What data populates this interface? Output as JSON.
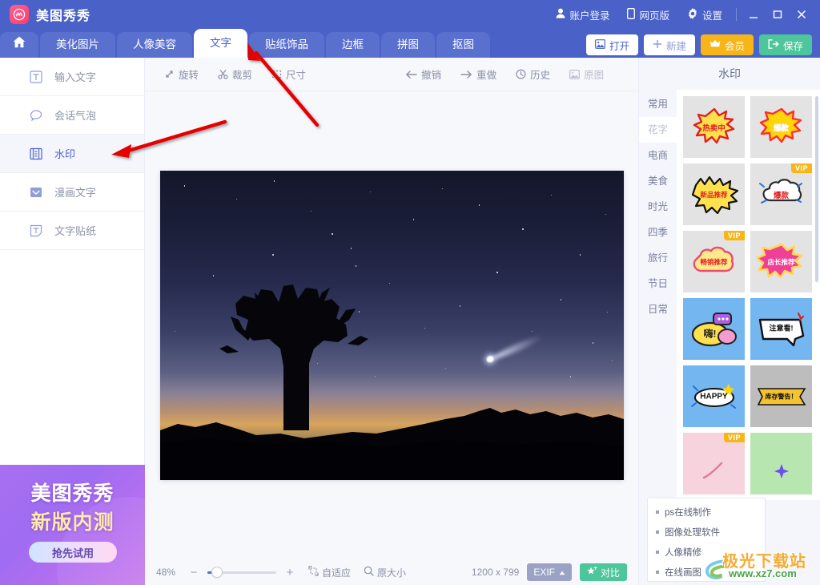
{
  "titlebar": {
    "app_name": "美图秀秀",
    "logo_icon": "meitu-logo-icon",
    "account": {
      "label": "账户登录",
      "icon": "user-icon"
    },
    "web_version": {
      "label": "网页版",
      "icon": "phone-icon"
    },
    "settings": {
      "label": "设置",
      "icon": "gear-icon"
    },
    "minimize_icon": "minimize-icon",
    "maximize_icon": "maximize-icon",
    "close_icon": "close-icon"
  },
  "tabs": {
    "home_icon": "home-icon",
    "items": [
      {
        "label": "美化图片",
        "active": false
      },
      {
        "label": "人像美容",
        "active": false
      },
      {
        "label": "文字",
        "active": true
      },
      {
        "label": "贴纸饰品",
        "active": false
      },
      {
        "label": "边框",
        "active": false
      },
      {
        "label": "拼图",
        "active": false
      },
      {
        "label": "抠图",
        "active": false
      }
    ],
    "actions": [
      {
        "label": "打开",
        "icon": "image-icon",
        "style": "white"
      },
      {
        "label": "新建",
        "icon": "plus-icon",
        "style": "ghost"
      },
      {
        "label": "会员",
        "icon": "crown-icon",
        "style": "gold"
      },
      {
        "label": "保存",
        "icon": "save-icon",
        "style": "green"
      }
    ]
  },
  "sidebar": {
    "items": [
      {
        "label": "输入文字",
        "icon": "text-input-icon",
        "active": false
      },
      {
        "label": "会话气泡",
        "icon": "speech-bubble-icon",
        "active": false
      },
      {
        "label": "水印",
        "icon": "watermark-icon",
        "active": true
      },
      {
        "label": "漫画文字",
        "icon": "comic-text-icon",
        "active": false
      },
      {
        "label": "文字贴纸",
        "icon": "text-sticker-icon",
        "active": false
      }
    ],
    "promo": {
      "line1": "美图秀秀",
      "line2": "新版内测",
      "button": "抢先试用"
    }
  },
  "toolbar": {
    "items": [
      {
        "label": "旋转",
        "icon": "rotate-icon",
        "dim": false
      },
      {
        "label": "裁剪",
        "icon": "crop-icon",
        "dim": false
      },
      {
        "label": "尺寸",
        "icon": "resize-icon",
        "dim": false
      }
    ],
    "history_items": [
      {
        "label": "撤销",
        "icon": "undo-arrow-icon",
        "dim": false
      },
      {
        "label": "重做",
        "icon": "redo-arrow-icon",
        "dim": false
      },
      {
        "label": "历史",
        "icon": "clock-icon",
        "dim": false
      },
      {
        "label": "原图",
        "icon": "original-image-icon",
        "dim": true
      }
    ]
  },
  "statusbar": {
    "zoom_percent": "48%",
    "zoom_out_icon": "minus-icon",
    "zoom_in_icon": "plus-icon",
    "fit_label": "自适应",
    "fit_icon": "fit-screen-icon",
    "actual_label": "原大小",
    "actual_icon": "magnifier-icon",
    "dimensions": "1200 x 799",
    "exif_label": "EXIF",
    "exif_caret_icon": "caret-up-icon",
    "compare_label": "对比",
    "compare_icon": "star-compare-icon"
  },
  "right_panel": {
    "title": "水印",
    "categories": [
      {
        "label": "常用",
        "active": false
      },
      {
        "label": "花字",
        "active": true
      },
      {
        "label": "电商",
        "active": false
      },
      {
        "label": "美食",
        "active": false
      },
      {
        "label": "时光",
        "active": false
      },
      {
        "label": "四季",
        "active": false
      },
      {
        "label": "旅行",
        "active": false
      },
      {
        "label": "节日",
        "active": false
      },
      {
        "label": "日常",
        "active": false
      }
    ],
    "stickers": [
      {
        "label": "热卖中",
        "vip": false,
        "bg": "#e3e3e3",
        "burst": "#ffe14d",
        "outline": "#e02020",
        "text_color": "#e02020"
      },
      {
        "label": "爆款",
        "vip": false,
        "bg": "#e3e3e3",
        "burst": "#ffd60a",
        "outline": "#ff2d2d",
        "text_color": "#ffffff"
      },
      {
        "label": "新品推荐",
        "vip": false,
        "bg": "#e3e3e3",
        "burst": "#ffe14d",
        "outline": "#111111",
        "text_color": "#e02020"
      },
      {
        "label": "爆款",
        "vip": true,
        "bg": "#e3e3e3",
        "burst": "#ffffff",
        "outline": "#3b7de0",
        "text_color": "#e02020"
      },
      {
        "label": "畅销推荐",
        "vip": true,
        "bg": "#e3e3e3",
        "burst": "#ffe98a",
        "outline": "#ef4b6b",
        "text_color": "#e02020"
      },
      {
        "label": "店长推荐",
        "vip": false,
        "bg": "#e3e3e3",
        "burst": "#ef3f96",
        "outline": "#ffd84d",
        "text_color": "#ffffff"
      },
      {
        "label": "嗨!",
        "vip": false,
        "bg": "#74b6f0",
        "burst": "#ffe14d",
        "outline": "#222222",
        "text_color": "#222222"
      },
      {
        "label": "注意看!",
        "vip": false,
        "bg": "#74b6f0",
        "burst": "#ffffff",
        "outline": "#111111",
        "text_color": "#111111"
      },
      {
        "label": "HAPPY",
        "vip": false,
        "bg": "#74b6f0",
        "burst": "#ffffff",
        "outline": "#111111",
        "text_color": "#111111"
      },
      {
        "label": "库存警告！",
        "vip": false,
        "bg": "#bdbdbd",
        "burst": "#f5c330",
        "outline": "#111111",
        "text_color": "#111111"
      },
      {
        "label": "",
        "vip": true,
        "bg": "#f7d3de",
        "burst": "#f7d3de",
        "outline": "#e07ba0",
        "text_color": "#e07ba0"
      },
      {
        "label": "",
        "vip": false,
        "bg": "#b8e6b0",
        "burst": "#b8e6b0",
        "outline": "#6b4df0",
        "text_color": "#6b4df0"
      }
    ],
    "links": [
      "ps在线制作",
      "图像处理软件",
      "人像精修",
      "在线画图"
    ]
  },
  "watermark": {
    "text": "极光下载站",
    "url": "www.xz7.com"
  },
  "canvas": {
    "image_alt": "joshua-tree-night-sky-with-comet"
  }
}
